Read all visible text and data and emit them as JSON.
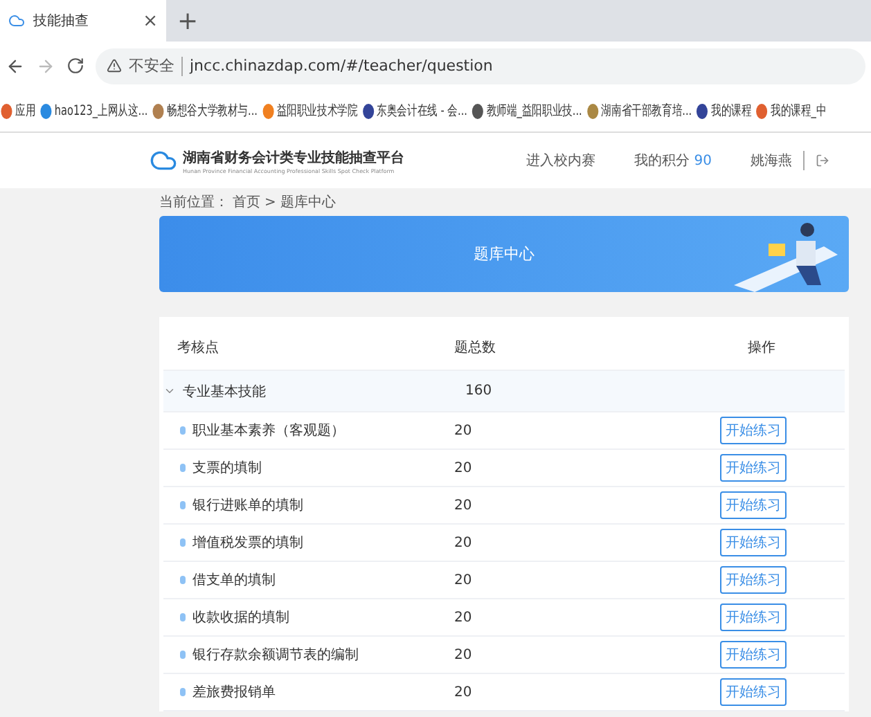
{
  "browser": {
    "tab": {
      "title": "技能抽查",
      "close": "×"
    },
    "new_tab": "+",
    "address": {
      "security": "不安全",
      "url": "jncc.chinazdap.com/#/teacher/question"
    },
    "bookmarks": [
      "应用",
      "hao123_上网从这...",
      "畅想谷大学教材与...",
      "益阳职业技术学院",
      "东奥会计在线 - 会...",
      "教师端_益阳职业技...",
      "湖南省干部教育培...",
      "我的课程",
      "我的课程_中"
    ]
  },
  "header": {
    "title": "湖南省财务会计类专业技能抽查平台",
    "subtitle": "Hunan Province Financial Accounting Professional Skills Spot Check Platform",
    "nav": [
      "进入校内赛",
      "我的积分"
    ],
    "points": "90",
    "user": "姚海燕"
  },
  "breadcrumb": {
    "label": "当前位置：",
    "items": [
      "首页",
      "题库中心"
    ],
    "separator": ">"
  },
  "banner": {
    "title": "题库中心"
  },
  "table": {
    "columns": [
      "考核点",
      "题总数",
      "操作"
    ],
    "groups": [
      {
        "name": "专业基本技能",
        "total": "160",
        "expanded": true,
        "rows": [
          {
            "name": "职业基本素养（客观题）",
            "count": "20",
            "action": "开始练习"
          },
          {
            "name": "支票的填制",
            "count": "20",
            "action": "开始练习"
          },
          {
            "name": "银行进账单的填制",
            "count": "20",
            "action": "开始练习"
          },
          {
            "name": "增值税发票的填制",
            "count": "20",
            "action": "开始练习"
          },
          {
            "name": "借支单的填制",
            "count": "20",
            "action": "开始练习"
          },
          {
            "name": "收款收据的填制",
            "count": "20",
            "action": "开始练习"
          },
          {
            "name": "银行存款余额调节表的编制",
            "count": "20",
            "action": "开始练习"
          },
          {
            "name": "差旅费报销单",
            "count": "20",
            "action": "开始练习"
          }
        ]
      }
    ]
  }
}
